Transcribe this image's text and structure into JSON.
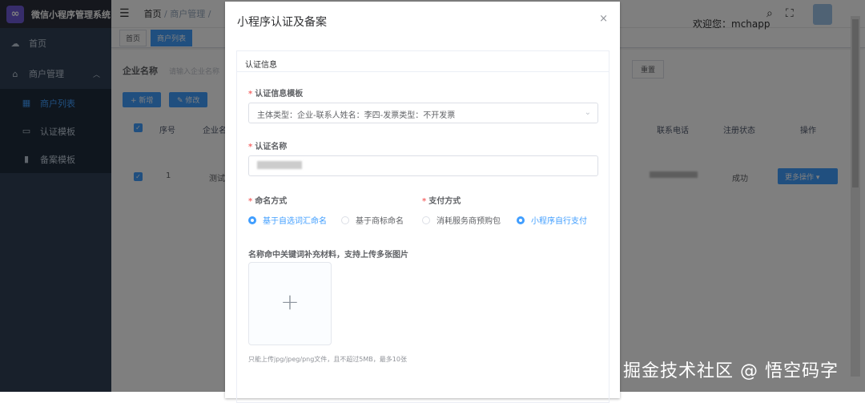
{
  "sidebar": {
    "title": "微信小程序管理系统",
    "items": [
      {
        "label": "首页"
      },
      {
        "label": "商户管理"
      }
    ],
    "sub": [
      {
        "label": "商户列表"
      },
      {
        "label": "认证模板"
      },
      {
        "label": "备案模板"
      }
    ]
  },
  "header": {
    "breadcrumb": [
      "首页",
      "商户管理"
    ],
    "welcome": "欢迎您：mchapp"
  },
  "tags": [
    "首页",
    "商户列表"
  ],
  "search": {
    "label": "企业名称",
    "placeholder": "请输入企业名称",
    "reset": "重置"
  },
  "toolbar": {
    "add": "+ 新增",
    "edit": "✎ 修改"
  },
  "table": {
    "headers": [
      "序号",
      "企业名",
      "联系电话",
      "注册状态",
      "操作"
    ],
    "row": {
      "index": "1",
      "name": "测试",
      "status": "成功",
      "action": "更多操作"
    }
  },
  "dialog": {
    "title": "小程序认证及备案",
    "close": "×",
    "tab": "认证信息",
    "template_label": "认证信息模板",
    "template_value": "主体类型：企业-联系人姓名：李四-发票类型：不开发票",
    "name_label": "认证名称",
    "naming_label": "命名方式",
    "naming_options": [
      "基于自选词汇命名",
      "基于商标命名"
    ],
    "pay_label": "支付方式",
    "pay_options": [
      "消耗服务商预购包",
      "小程序自行支付"
    ],
    "upload_label": "名称命中关键词补充材料，支持上传多张图片",
    "upload_hint": "只能上传jpg/jpeg/png文件，且不超过5MB，最多10张"
  },
  "watermark": "掘金技术社区 @ 悟空码字"
}
